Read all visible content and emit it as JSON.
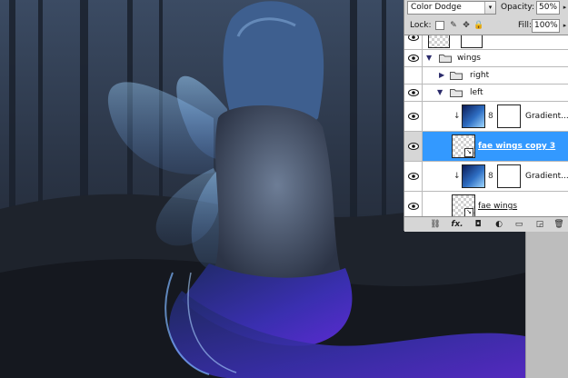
{
  "panel": {
    "blend_mode": "Color Dodge",
    "blend_arrow": "▾",
    "opacity_label": "Opacity:",
    "opacity_value": "50%",
    "lock_label": "Lock:",
    "fill_label": "Fill:",
    "fill_value": "100%",
    "stepper_arrow": "▸"
  },
  "layers": [
    {
      "name": "",
      "type": "partial-top",
      "visible": true
    },
    {
      "name": "wings",
      "type": "group-open",
      "visible": true
    },
    {
      "name": "right",
      "type": "group-closed",
      "visible": false
    },
    {
      "name": "left",
      "type": "group-open",
      "visible": true
    },
    {
      "name": "Gradient...",
      "type": "adjustment",
      "visible": true
    },
    {
      "name": "fae wings copy 3",
      "type": "pixel",
      "visible": true,
      "selected": true
    },
    {
      "name": "Gradient...",
      "type": "adjustment",
      "visible": true
    },
    {
      "name": "fae wings",
      "type": "pixel",
      "visible": true
    }
  ],
  "footer": {
    "link_icon": "⛓",
    "fx_label": "fx.",
    "mask_icon": "◘",
    "adjust_icon": "◐",
    "group_icon": "▭",
    "new_icon": "◲",
    "trash_icon": "🗑"
  },
  "icons": {
    "chain": "8",
    "clip": "↓",
    "lock_brush": "✎",
    "lock_move": "✥",
    "lock_all": "🔒",
    "tri_open": "▼",
    "tri_closed": "▶"
  },
  "colors": {
    "selection": "#3399ff",
    "panel_bg": "#d6d6d6",
    "canvas_dark": "#1c2330"
  }
}
